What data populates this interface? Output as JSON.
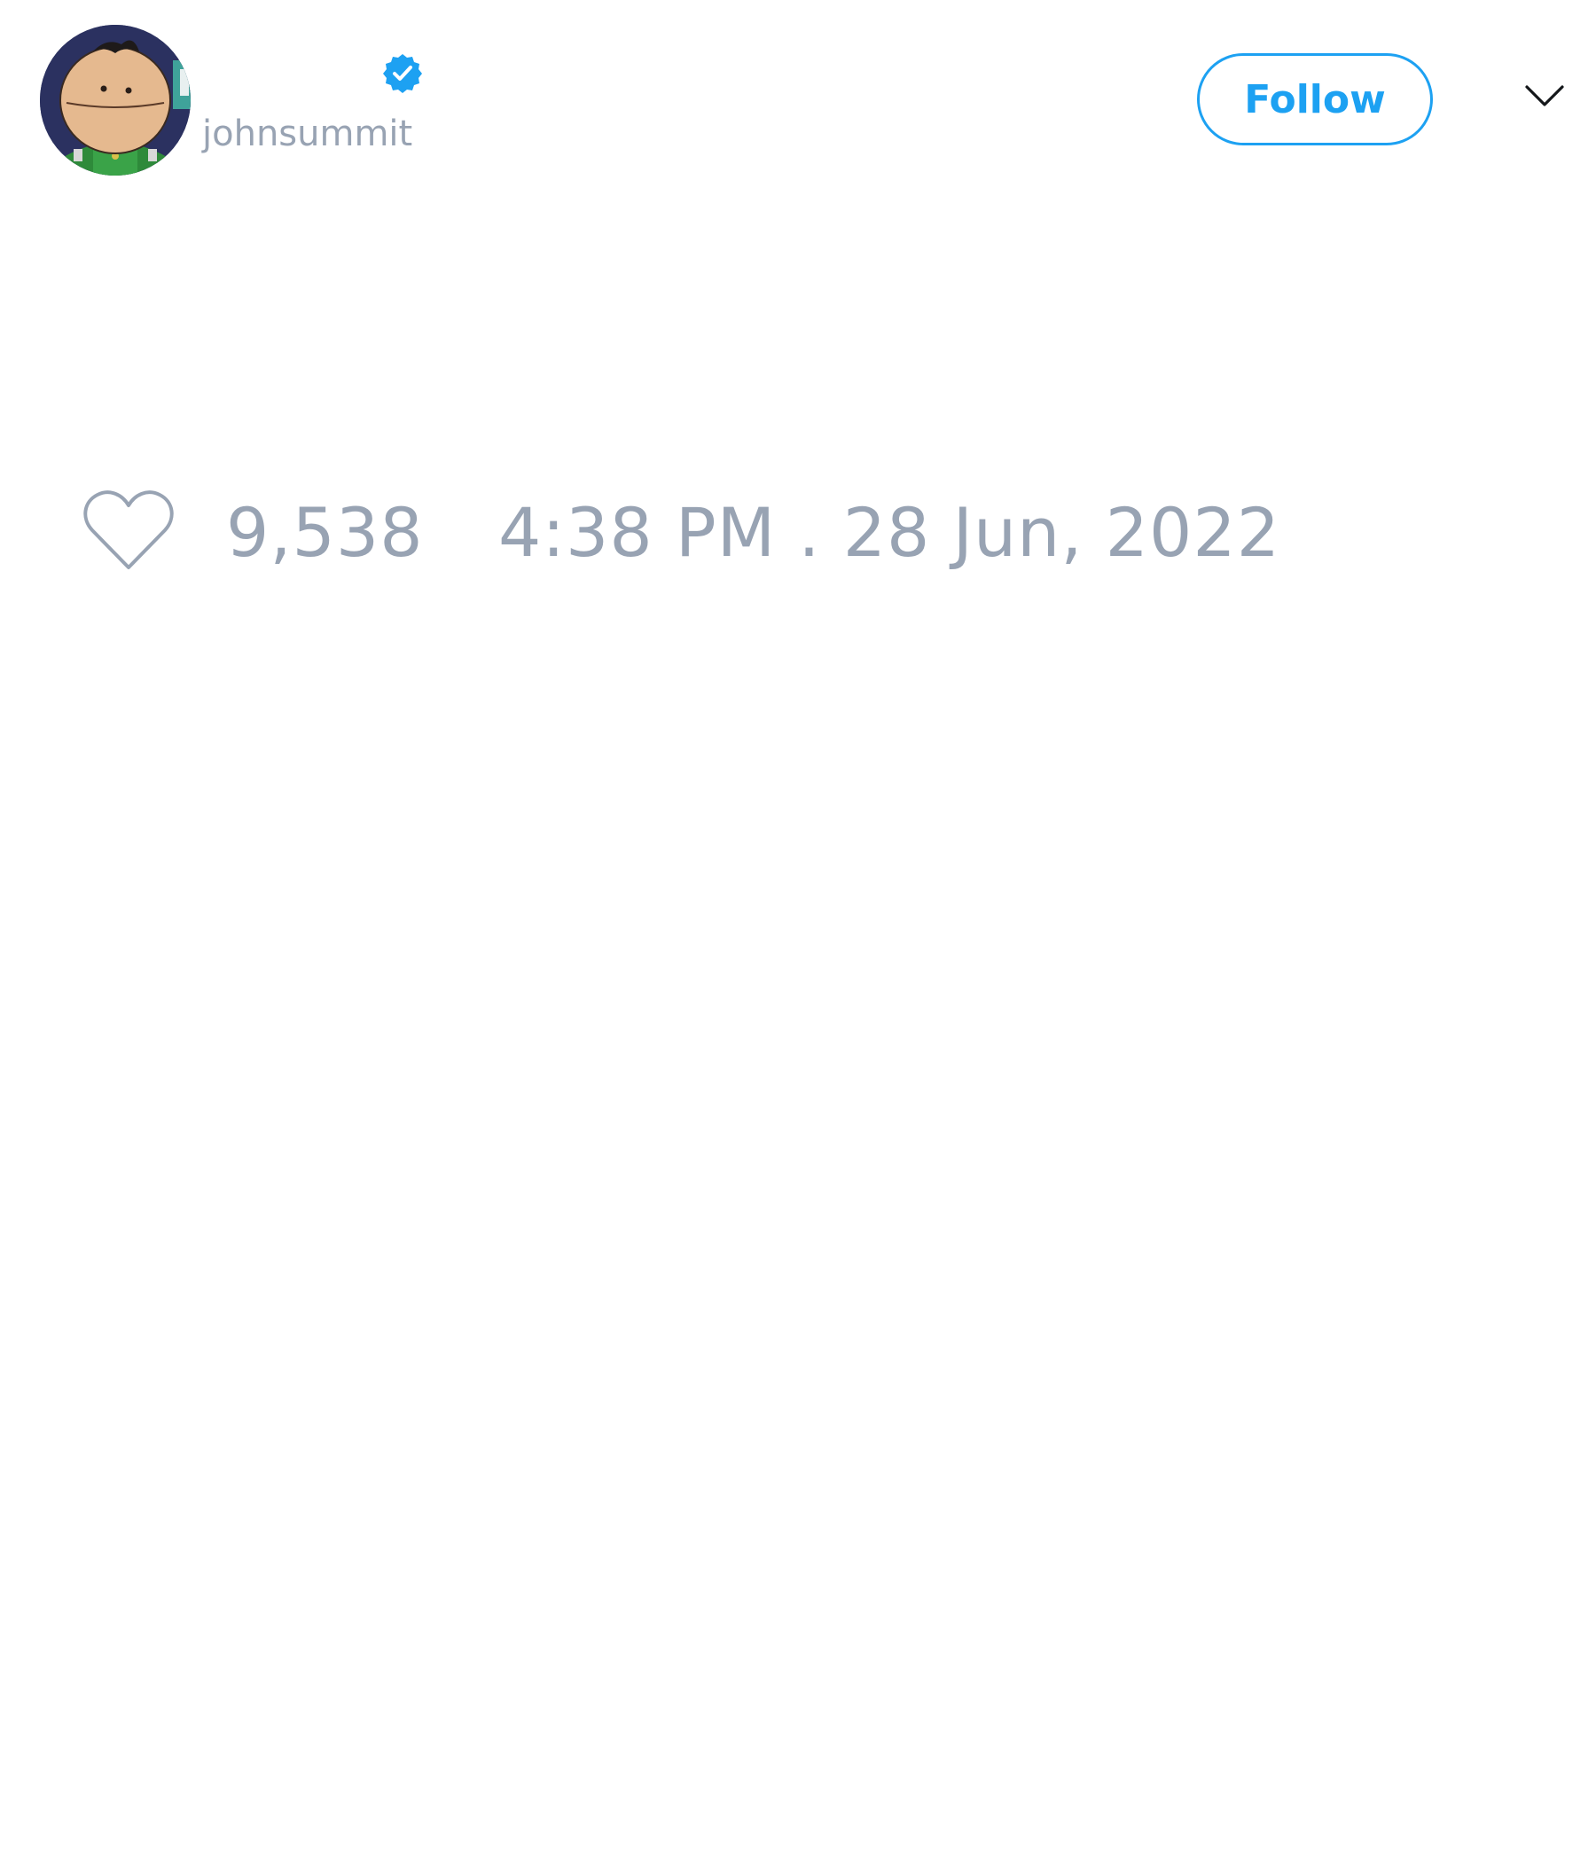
{
  "author": {
    "display_name": "",
    "handle": "johnsummit",
    "verified": true,
    "avatar_icon": "cartoon-character-avatar"
  },
  "actions": {
    "follow_label": "Follow",
    "menu_icon": "chevron-down-icon"
  },
  "stats": {
    "like_icon": "heart-outline-icon",
    "like_count": "9,538"
  },
  "timestamp": "4:38 PM . 28 Jun, 2022",
  "colors": {
    "accent": "#1da1f2",
    "muted_text": "#98a3b3",
    "background": "#ffffff"
  }
}
